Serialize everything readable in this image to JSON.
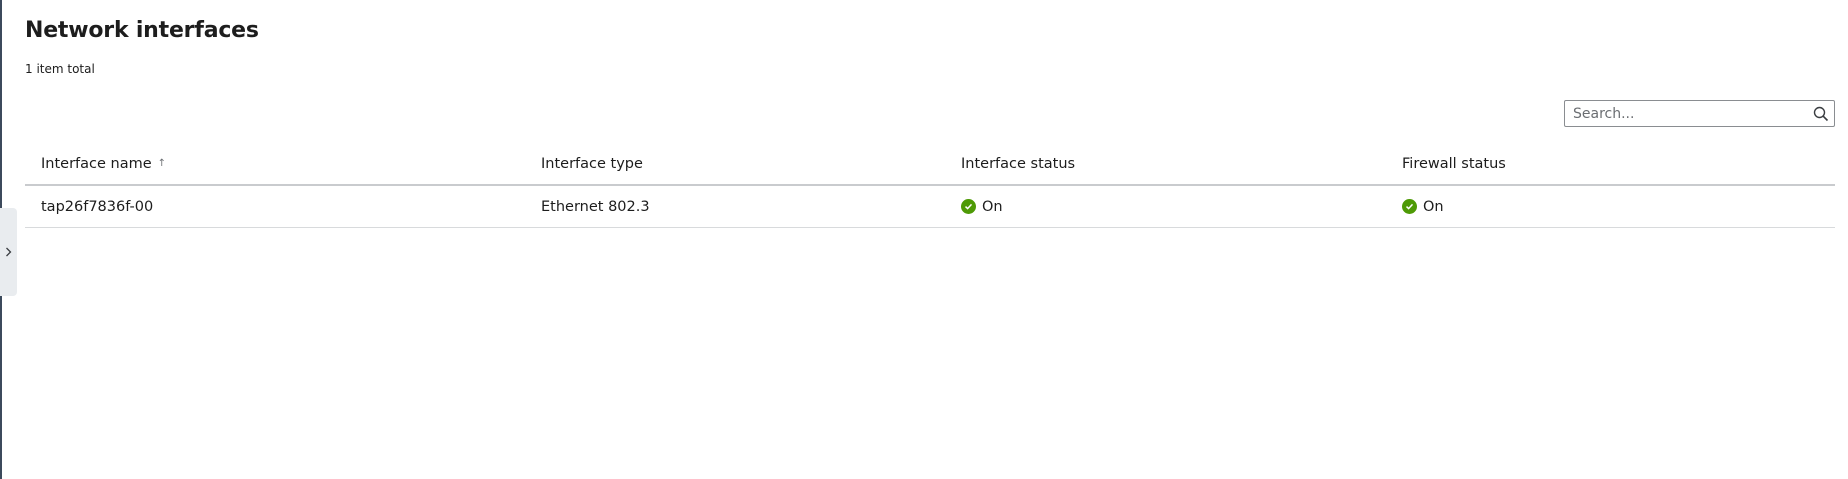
{
  "page": {
    "title": "Network interfaces",
    "item_count": "1 item total"
  },
  "search": {
    "placeholder": "Search...",
    "value": ""
  },
  "table": {
    "columns": [
      {
        "label": "Interface name",
        "sorted": "ascending"
      },
      {
        "label": "Interface type"
      },
      {
        "label": "Interface status"
      },
      {
        "label": "Firewall status"
      }
    ],
    "rows": [
      {
        "interface_name": "tap26f7836f-00",
        "interface_type": "Ethernet 802.3",
        "interface_status": "On",
        "firewall_status": "On"
      }
    ]
  },
  "icons": {
    "sidebar_toggle": "chevron-right-icon",
    "search": "search-icon",
    "sort": "arrow-up-icon",
    "status_on": "check-circle-icon"
  },
  "colors": {
    "status_on": "#4e9a06",
    "header_border": "#c9cbce",
    "row_border": "#d8dadc",
    "sidebar_toggle_bg": "#e9ecef",
    "left_border": "#3c4a5c"
  }
}
